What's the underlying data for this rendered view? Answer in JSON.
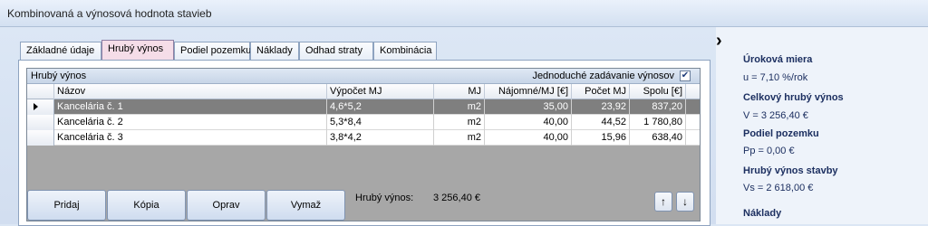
{
  "window": {
    "title": "Kombinovaná a výnosová hodnota stavieb"
  },
  "tabs": [
    {
      "label": "Základné údaje",
      "active": false
    },
    {
      "label": "Hrubý výnos",
      "active": true
    },
    {
      "label": "Podiel pozemku",
      "active": false
    },
    {
      "label": "Náklady",
      "active": false
    },
    {
      "label": "Odhad straty",
      "active": false
    },
    {
      "label": "Kombinácia",
      "active": false
    }
  ],
  "grid": {
    "caption": "Hrubý výnos",
    "simple_entry_label": "Jednoduché zadávanie výnosov",
    "simple_entry_checked": true,
    "columns": [
      "Názov",
      "Výpočet MJ",
      "MJ",
      "Nájomné/MJ [€]",
      "Počet MJ",
      "Spolu [€]"
    ],
    "rows": [
      {
        "name": "Kancelária č. 1",
        "calc": "4,6*5,2",
        "unit": "m2",
        "rent": "35,00",
        "count": "23,92",
        "total": "837,20",
        "selected": true
      },
      {
        "name": "Kancelária č. 2",
        "calc": "5,3*8,4",
        "unit": "m2",
        "rent": "40,00",
        "count": "44,52",
        "total": "1 780,80",
        "selected": false
      },
      {
        "name": "Kancelária č. 3",
        "calc": "3,8*4,2",
        "unit": "m2",
        "rent": "40,00",
        "count": "15,96",
        "total": "638,40",
        "selected": false
      }
    ]
  },
  "buttons": {
    "add": "Pridaj",
    "copy": "Kópia",
    "edit": "Oprav",
    "delete": "Vymaž"
  },
  "total": {
    "label": "Hrubý výnos:",
    "value": "3 256,40 €"
  },
  "summary": {
    "rate_title": "Úroková miera",
    "rate_value": "u = 7,10 %/rok",
    "gross_title": "Celkový hrubý výnos",
    "gross_value": "V =  3 256,40 €",
    "land_title": "Podiel pozemku",
    "land_value": "Pp =   0,00 €",
    "building_title": "Hrubý výnos stavby",
    "building_value": "Vs =  2 618,00 €",
    "costs_title": "Náklady"
  }
}
